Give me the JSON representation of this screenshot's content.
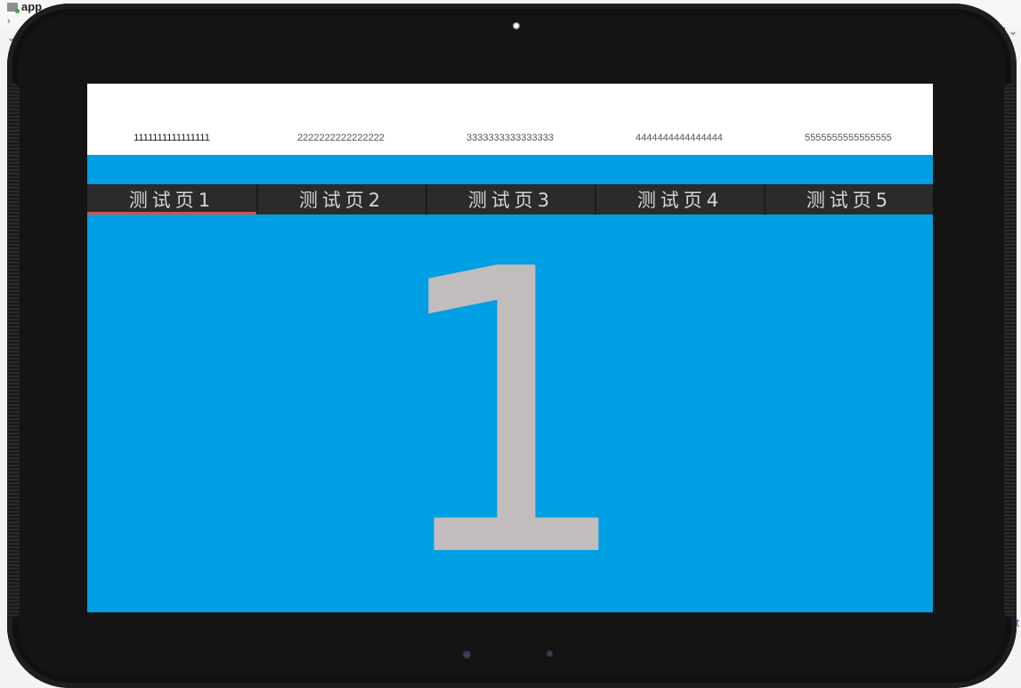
{
  "ide": {
    "project_label": "app",
    "right_fragment": "l ⌄",
    "right_fragment2": "t"
  },
  "top_tabs": [
    {
      "label": "1111111111111111",
      "active": true
    },
    {
      "label": "2222222222222222",
      "active": false
    },
    {
      "label": "3333333333333333",
      "active": false
    },
    {
      "label": "4444444444444444",
      "active": false
    },
    {
      "label": "5555555555555555",
      "active": false
    }
  ],
  "tabs": [
    {
      "label": "测试页1",
      "active": true
    },
    {
      "label": "测试页2",
      "active": false
    },
    {
      "label": "测试页3",
      "active": false
    },
    {
      "label": "测试页4",
      "active": false
    },
    {
      "label": "测试页5",
      "active": false
    }
  ],
  "page": {
    "content": "1"
  },
  "colors": {
    "screen_background": "#009fe3",
    "tab_bar": "#2b2b2b",
    "indicator": "#e5484d",
    "content_text": "#c3bcbc"
  }
}
